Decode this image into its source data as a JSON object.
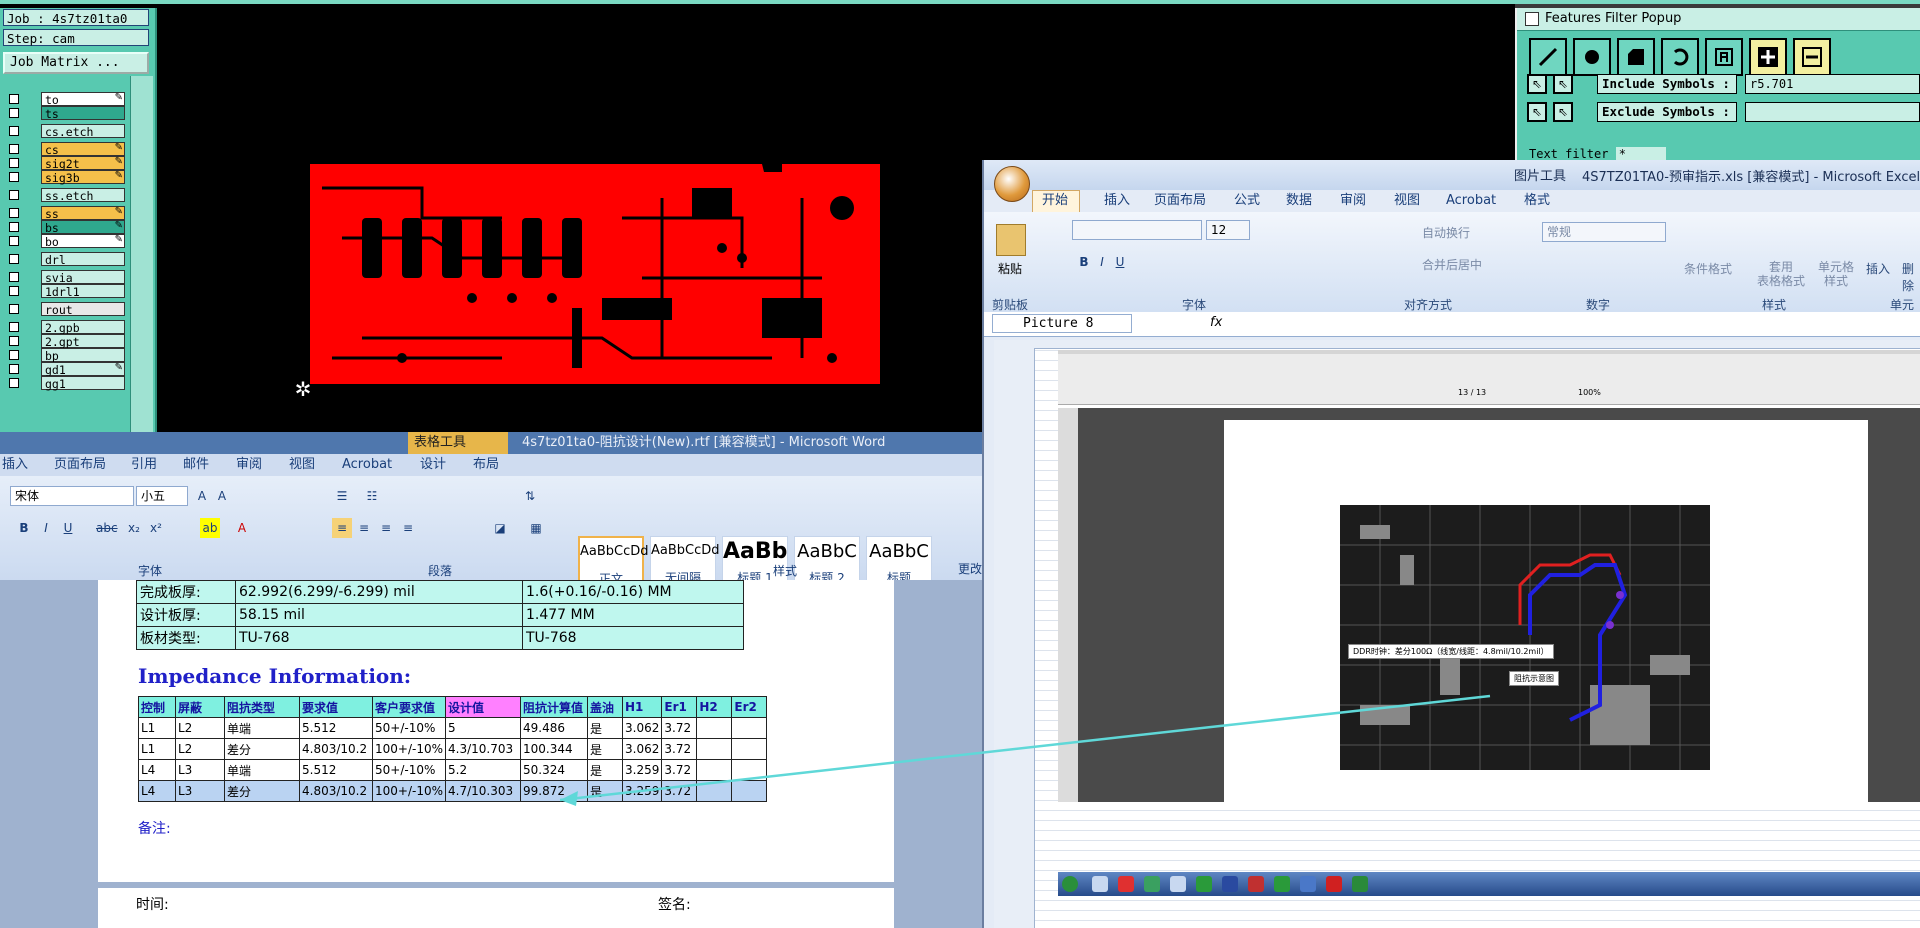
{
  "cam": {
    "job": "Job : 4s7tz01ta0",
    "step": "Step: cam",
    "job_matrix": "Job Matrix ...",
    "layers": [
      {
        "name": "to",
        "color": "#ffffff",
        "edit": true
      },
      {
        "name": "ts",
        "color": "#2fa88e",
        "edit": false
      },
      {
        "name": "cs.etch",
        "color": "#c9efe5",
        "edit": false
      },
      {
        "name": "cs",
        "color": "#f5c04a",
        "edit": true
      },
      {
        "name": "sig2t",
        "color": "#f5c04a",
        "edit": true
      },
      {
        "name": "sig3b",
        "color": "#f5c04a",
        "edit": true
      },
      {
        "name": "ss.etch",
        "color": "#c9efe5",
        "edit": false
      },
      {
        "name": "ss",
        "color": "#f5c04a",
        "edit": true
      },
      {
        "name": "bs",
        "color": "#2fa88e",
        "edit": true
      },
      {
        "name": "bo",
        "color": "#ffffff",
        "edit": true
      },
      {
        "name": "drl",
        "color": "#c9efe5",
        "edit": false
      },
      {
        "name": "svia",
        "color": "#c9efe5",
        "edit": false
      },
      {
        "name": "1drl1",
        "color": "#c9efe5",
        "edit": false
      },
      {
        "name": "rout",
        "color": "#e8e8e8",
        "edit": false
      },
      {
        "name": "2.gpb",
        "color": "#c9efe5",
        "edit": false
      },
      {
        "name": "2.gpt",
        "color": "#c9efe5",
        "edit": false
      },
      {
        "name": "bp",
        "color": "#c9efe5",
        "edit": false
      },
      {
        "name": "gd1",
        "color": "#c9efe5",
        "edit": true
      },
      {
        "name": "gg1",
        "color": "#c9efe5",
        "edit": false
      }
    ],
    "pcb_color": "#ff0000"
  },
  "features_filter": {
    "title": "Features Filter Popup",
    "include_label": "Include Symbols :",
    "include_value": "r5.701",
    "exclude_label": "Exclude Symbols :",
    "exclude_value": "",
    "text_filter_label": "Text filter",
    "text_filter_value": "*"
  },
  "word": {
    "context_tab": "表格工具",
    "title": "4s7tz01ta0-阻抗设计(New).rtf [兼容模式] - Microsoft Word",
    "tabs": [
      "插入",
      "页面布局",
      "引用",
      "邮件",
      "审阅",
      "视图",
      "Acrobat",
      "设计",
      "布局"
    ],
    "font_name": "宋体",
    "font_size": "小五",
    "groups": [
      "字体",
      "段落",
      "样式"
    ],
    "styles": [
      {
        "sample": "AaBbCcDd",
        "name": "正文"
      },
      {
        "sample": "AaBbCcDd",
        "name": "无间隔"
      },
      {
        "sample": "AaBb",
        "name": "标题 1"
      },
      {
        "sample": "AaBbC",
        "name": "标题 2"
      },
      {
        "sample": "AaBbC",
        "name": "标题"
      }
    ],
    "more_styles": "更改",
    "info_rows": [
      [
        "完成板厚:",
        "62.992(6.299/-6.299) mil",
        "1.6(+0.16/-0.16) MM"
      ],
      [
        "设计板厚:",
        "58.15 mil",
        "1.477 MM"
      ],
      [
        "板材类型:",
        "TU-768",
        "TU-768"
      ]
    ],
    "impedance_heading": "Impedance Information:",
    "imp_headers": [
      "控制",
      "屏蔽",
      "阻抗类型",
      "要求值",
      "客户要求值",
      "设计值",
      "阻抗计算值",
      "盖油",
      "H1",
      "Er1",
      "H2",
      "Er2"
    ],
    "imp_rows": [
      [
        "L1",
        "L2",
        "单端",
        "5.512",
        "50+/-10%",
        "5",
        "49.486",
        "是",
        "3.062",
        "3.72",
        "",
        ""
      ],
      [
        "L1",
        "L2",
        "差分",
        "4.803/10.2",
        "100+/-10%",
        "4.3/10.703",
        "100.344",
        "是",
        "3.062",
        "3.72",
        "",
        ""
      ],
      [
        "L4",
        "L3",
        "单端",
        "5.512",
        "50+/-10%",
        "5.2",
        "50.324",
        "是",
        "3.259",
        "3.72",
        "",
        ""
      ],
      [
        "L4",
        "L3",
        "差分",
        "4.803/10.2",
        "100+/-10%",
        "4.7/10.303",
        "99.872",
        "是",
        "3.259",
        "3.72",
        "",
        ""
      ]
    ],
    "note": "备注:",
    "footer_left": "时间:",
    "footer_right": "签名:"
  },
  "excel": {
    "context_tab": "图片工具",
    "title": "4S7TZ01TA0-预审指示.xls [兼容模式] - Microsoft Excel",
    "tabs": [
      "开始",
      "插入",
      "页面布局",
      "公式",
      "数据",
      "审阅",
      "视图",
      "Acrobat",
      "格式"
    ],
    "font_size": "12",
    "number_format": "常规",
    "paste": "粘贴",
    "wrap_text": "自动换行",
    "merge_center": "合并后居中",
    "conditional_format": "条件格式",
    "table_format": "套用\n表格格式",
    "cell_style": "单元格\n样式",
    "insert": "插入",
    "delete": "删除",
    "groups": [
      "剪贴板",
      "字体",
      "对齐方式",
      "数字",
      "样式",
      "单元"
    ],
    "name_box": "Picture 8",
    "fx": "fx",
    "acrobat_zoom": "100%",
    "acrobat_page": "13 / 13",
    "caption1": "DDR时钟：差分100Ω（线宽/线距：4.8mil/10.2mil）",
    "caption2": "阻抗示意图"
  }
}
